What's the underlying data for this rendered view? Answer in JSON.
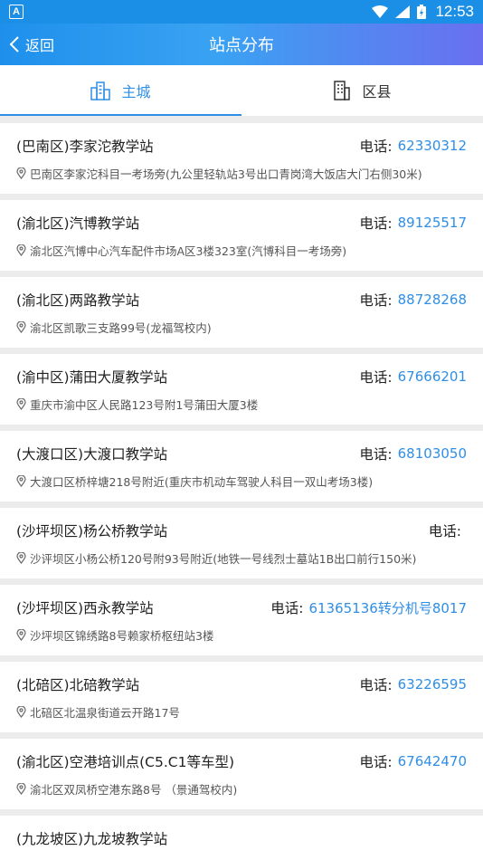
{
  "status_bar": {
    "app_badge": "A",
    "time": "12:53"
  },
  "nav": {
    "back_label": "返回",
    "title": "站点分布"
  },
  "tabs": [
    {
      "label": "主城",
      "active": true
    },
    {
      "label": "区县",
      "active": false
    }
  ],
  "phone_label": "电话:",
  "colors": {
    "accent": "#2f8ee6",
    "status_bar": "#1b8fe6"
  },
  "stations": [
    {
      "name": "(巴南区)李家沱教学站",
      "phone": "62330312",
      "address": "巴南区李家沱科目一考场旁(九公里轻轨站3号出口青岗湾大饭店大门右侧30米)"
    },
    {
      "name": "(渝北区)汽博教学站",
      "phone": "89125517",
      "address": "渝北区汽博中心汽车配件市场A区3楼323室(汽博科目一考场旁)"
    },
    {
      "name": "(渝北区)两路教学站",
      "phone": "88728268",
      "address": "渝北区凯歌三支路99号(龙福驾校内)"
    },
    {
      "name": "(渝中区)蒲田大厦教学站",
      "phone": "67666201",
      "address": "重庆市渝中区人民路123号附1号蒲田大厦3楼"
    },
    {
      "name": "(大渡口区)大渡口教学站",
      "phone": "68103050",
      "address": "大渡口区桥梓塘218号附近(重庆市机动车驾驶人科目一双山考场3楼)"
    },
    {
      "name": "(沙坪坝区)杨公桥教学站",
      "phone": "",
      "address": "沙评坝区小杨公桥120号附93号附近(地铁一号线烈士墓站1B出口前行150米)"
    },
    {
      "name": "(沙坪坝区)西永教学站",
      "phone": "61365136转分机号8017",
      "address": "沙坪坝区锦绣路8号赖家桥枢纽站3楼"
    },
    {
      "name": "(北碚区)北碚教学站",
      "phone": "63226595",
      "address": "北碚区北温泉街道云开路17号"
    },
    {
      "name": "(渝北区)空港培训点(C5.C1等车型)",
      "phone": "67642470",
      "address": "渝北区双凤桥空港东路8号 （景通驾校内)"
    },
    {
      "name": "(九龙坡区)九龙坡教学站",
      "phone": "",
      "address": ""
    }
  ]
}
